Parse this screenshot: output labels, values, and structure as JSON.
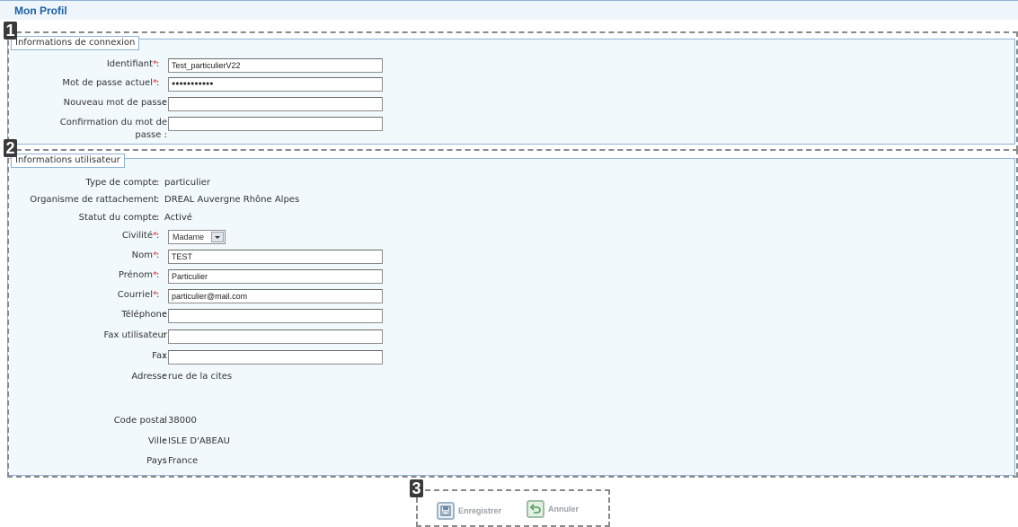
{
  "page": {
    "title": "Mon Profil"
  },
  "markers": [
    "1",
    "2",
    "3"
  ],
  "connexion": {
    "legend": "Informations de connexion",
    "fields": [
      {
        "label": "Identifiant",
        "required": "*",
        "sep": ":",
        "value": "Test_particulierV22"
      },
      {
        "label": "Mot de passe actuel",
        "required": "*",
        "sep": ":",
        "value": "●●●●●●●●●●●"
      },
      {
        "label": "Nouveau mot de passe",
        "sep": ":",
        "value": ""
      },
      {
        "label_line1": "Confirmation du mot de",
        "label_line2": "passe",
        "sep": ":",
        "value": ""
      }
    ]
  },
  "utilisateur": {
    "legend": "Informations utilisateur",
    "type_compte": {
      "label": "Type de compte",
      "sep": ":",
      "value": "particulier"
    },
    "organisme": {
      "label": "Organisme de rattachement",
      "sep": ":",
      "value": "DREAL Auvergne Rhône Alpes"
    },
    "statut": {
      "label": "Statut du compte",
      "sep": ":",
      "value": "Activé"
    },
    "civilite": {
      "label": "Civilité",
      "required": "*",
      "sep": ":",
      "value": "Madame"
    },
    "nom": {
      "label": "Nom",
      "required": "*",
      "sep": ":",
      "value": "TEST"
    },
    "prenom": {
      "label": "Prénom",
      "required": "*",
      "sep": ":",
      "value": "Particulier"
    },
    "courriel": {
      "label": "Courriel",
      "required": "*",
      "sep": ":",
      "value": "particulier@mail.com"
    },
    "telephone": {
      "label": "Téléphone",
      "sep": ":",
      "value": ""
    },
    "fax_utilisateur": {
      "label": "Fax utilisateur",
      "sep": ":",
      "value": ""
    },
    "fax": {
      "label": "Fax",
      "sep": ":",
      "value": ""
    },
    "adresse": {
      "label": "Adresse",
      "sep": ":",
      "value": "rue de la cites"
    },
    "code_postal": {
      "label": "Code postal",
      "sep": ":",
      "value": "38000"
    },
    "ville": {
      "label": "Ville",
      "sep": ":",
      "value": "ISLE D'ABEAU"
    },
    "pays": {
      "label": "Pays",
      "sep": ":",
      "value": "France"
    }
  },
  "actions": {
    "save_label": "Enregistrer",
    "cancel_label": "Annuler"
  },
  "colors": {
    "title": "#1d5fa8",
    "required": "#e0282d",
    "section_bg": "#f2f9fd",
    "border": "#8fb3d6"
  },
  "icons": {
    "save": "save-icon",
    "cancel": "undo-icon"
  }
}
